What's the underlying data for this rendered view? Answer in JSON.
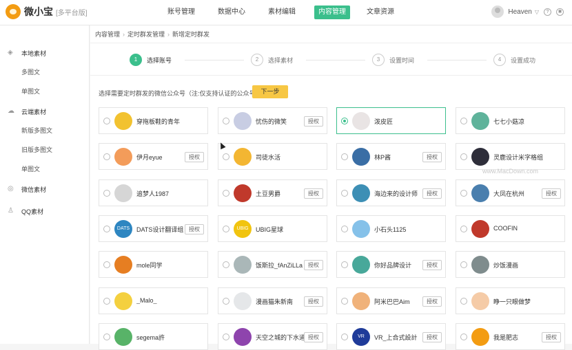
{
  "app": {
    "name": "微小宝",
    "platform_tag": "[多平台版]"
  },
  "nav": [
    "账号管理",
    "数据中心",
    "素材编辑",
    "内容管理",
    "文章资源"
  ],
  "nav_active_index": 3,
  "user": {
    "name": "Heaven",
    "help_icon": "?",
    "settings_icon": "gear-icon"
  },
  "sidebar": {
    "groups": [
      {
        "label": "本地素材",
        "icon": "layers-icon",
        "items": [
          "多图文",
          "单图文"
        ]
      },
      {
        "label": "云端素材",
        "icon": "cloud-icon",
        "items": [
          "新版多图文",
          "旧版多图文",
          "单图文"
        ]
      },
      {
        "label": "微信素材",
        "icon": "wechat-icon",
        "items": []
      },
      {
        "label": "QQ素材",
        "icon": "qq-icon",
        "items": []
      }
    ]
  },
  "breadcrumb": [
    "内容管理",
    "定时群发管理",
    "新增定时群发"
  ],
  "steps": [
    {
      "num": "1",
      "label": "选择账号",
      "active": true
    },
    {
      "num": "2",
      "label": "选择素材",
      "active": false
    },
    {
      "num": "3",
      "label": "设置时间",
      "active": false
    },
    {
      "num": "4",
      "label": "设置成功",
      "active": false
    }
  ],
  "instruction": "选择需要定时群发的微信公众号（注:仅支持认证的公众号）",
  "next_button": "下一步",
  "auth_label": "授权",
  "accounts": [
    {
      "name": "穿拖板鞋的青年",
      "auth": false,
      "selected": false,
      "color": "#f2c230",
      "mark": ""
    },
    {
      "name": "忧伤的微笑",
      "auth": true,
      "selected": false,
      "color": "#c8cde3",
      "mark": ""
    },
    {
      "name": "泼皮匠",
      "auth": false,
      "selected": true,
      "color": "#e9e4e4",
      "mark": ""
    },
    {
      "name": "七七小菇凉",
      "auth": false,
      "selected": false,
      "color": "#5fb39b",
      "mark": ""
    },
    {
      "name": "伊月eyue",
      "auth": true,
      "selected": false,
      "color": "#f39c5a",
      "mark": ""
    },
    {
      "name": "司徒水活",
      "auth": false,
      "selected": false,
      "color": "#f3b632",
      "mark": ""
    },
    {
      "name": "林P酱",
      "auth": true,
      "selected": false,
      "color": "#3a6ea5",
      "mark": ""
    },
    {
      "name": "灵鹿设计米字格组",
      "auth": false,
      "selected": false,
      "color": "#2e2e3a",
      "mark": ""
    },
    {
      "name": "追梦人1987",
      "auth": false,
      "selected": false,
      "color": "#d6d6d6",
      "mark": ""
    },
    {
      "name": "土豆男爵",
      "auth": true,
      "selected": false,
      "color": "#c0392b",
      "mark": ""
    },
    {
      "name": "海边来的设计师",
      "auth": true,
      "selected": false,
      "color": "#3d8fb5",
      "mark": ""
    },
    {
      "name": "大凤在杭州",
      "auth": true,
      "selected": false,
      "color": "#4a7fae",
      "mark": ""
    },
    {
      "name": "DATS设计翻译组",
      "auth": true,
      "selected": false,
      "color": "#2e86c1",
      "mark": "DATS"
    },
    {
      "name": "UBIG星球",
      "auth": false,
      "selected": false,
      "color": "#f1c40f",
      "mark": "UBIG"
    },
    {
      "name": "小石头1125",
      "auth": false,
      "selected": false,
      "color": "#85c1e9",
      "mark": ""
    },
    {
      "name": "COOFIN",
      "auth": false,
      "selected": false,
      "color": "#c0392b",
      "mark": ""
    },
    {
      "name": "mole同学",
      "auth": false,
      "selected": false,
      "color": "#e67e22",
      "mark": ""
    },
    {
      "name": "饭斯拉_fAnZiLLa",
      "auth": true,
      "selected": false,
      "color": "#aab7b8",
      "mark": ""
    },
    {
      "name": "你好品牌设计",
      "auth": true,
      "selected": false,
      "color": "#48a89a",
      "mark": ""
    },
    {
      "name": "炒饭漫画",
      "auth": false,
      "selected": false,
      "color": "#7f8c8d",
      "mark": ""
    },
    {
      "name": "_Malo_",
      "auth": false,
      "selected": false,
      "color": "#f4d03f",
      "mark": ""
    },
    {
      "name": "漫画猫朱新南",
      "auth": true,
      "selected": false,
      "color": "#e5e7e9",
      "mark": ""
    },
    {
      "name": "阿米巴巴Aim",
      "auth": true,
      "selected": false,
      "color": "#f0b27a",
      "mark": ""
    },
    {
      "name": "睁一只眼做梦",
      "auth": false,
      "selected": false,
      "color": "#f5cba7",
      "mark": ""
    },
    {
      "name": "segema許",
      "auth": false,
      "selected": false,
      "color": "#58b368",
      "mark": ""
    },
    {
      "name": "天空之城的下水道",
      "auth": true,
      "selected": false,
      "color": "#8e44ad",
      "mark": ""
    },
    {
      "name": "VR_上合式設計",
      "auth": true,
      "selected": false,
      "color": "#1f3b99",
      "mark": "VR"
    },
    {
      "name": "我是肥志",
      "auth": true,
      "selected": false,
      "color": "#f39c12",
      "mark": ""
    }
  ],
  "watermark": "www.MacDown.com"
}
